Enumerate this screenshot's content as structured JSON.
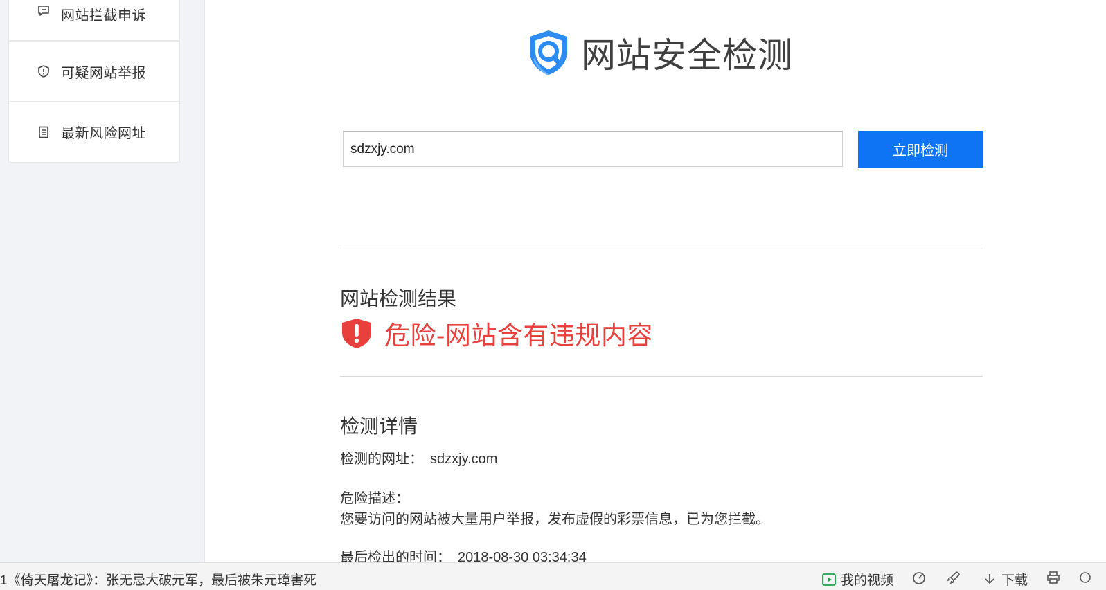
{
  "sidebar": {
    "items": [
      {
        "label": "网站拦截申诉",
        "icon": "speech-bubble-icon"
      },
      {
        "label": "可疑网站举报",
        "icon": "shield-alert-icon"
      },
      {
        "label": "最新风险网址",
        "icon": "document-list-icon"
      }
    ]
  },
  "header": {
    "title": "网站安全检测",
    "icon": "shield-search-logo-icon"
  },
  "search": {
    "value": "sdzxjy.com",
    "button_label": "立即检测"
  },
  "result": {
    "heading": "网站检测结果",
    "status_text": "危险-网站含有违规内容",
    "status_icon": "danger-shield-icon",
    "status_color": "#e8413d"
  },
  "details": {
    "heading": "检测详情",
    "url_label": "检测的网址：",
    "url_value": "sdzxjy.com",
    "description_label": "危险描述：",
    "description_text": "您要访问的网站被大量用户举报，发布虚假的彩票信息，已为您拦截。",
    "time_label": "最后检出的时间：",
    "time_value": "2018-08-30 03:34:34"
  },
  "bottombar": {
    "news": "1《倚天屠龙记》：张无忌大破元军，最后被朱元璋害死",
    "my_video": "我的视频",
    "download": "下载"
  },
  "colors": {
    "accent": "#0e74f3",
    "danger": "#e8413d"
  }
}
